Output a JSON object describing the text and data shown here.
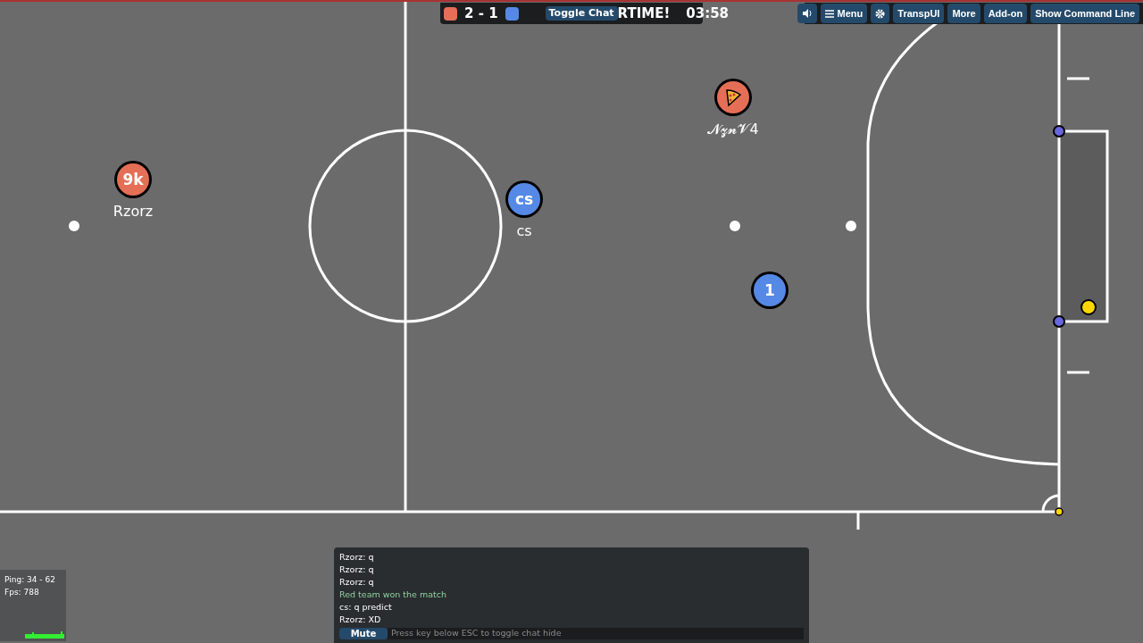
{
  "scoreboard": {
    "red_score": "2",
    "separator": "-",
    "blue_score": "1",
    "toggle_chat": "Toggle Chat",
    "banner": "RTIME!",
    "timer": "03:58"
  },
  "toolbar": [
    {
      "kind": "sound"
    },
    {
      "kind": "menu",
      "label": "Menu"
    },
    {
      "kind": "settings"
    },
    {
      "kind": "text",
      "label": "TranspUI"
    },
    {
      "kind": "text",
      "label": "More"
    },
    {
      "kind": "text",
      "label": "Add-on"
    },
    {
      "kind": "text",
      "label": "Show Command Line"
    }
  ],
  "players": [
    {
      "color": "#e56e56",
      "kind": "text",
      "avatar": "9k",
      "name": "Rzorz"
    },
    {
      "color": "#5689e5",
      "kind": "text",
      "avatar": "cs",
      "name": "cs"
    },
    {
      "color": "#e56e56",
      "kind": "pizza",
      "name": "𝓝𝔃𝓷𝓥4"
    },
    {
      "color": "#5689e5",
      "kind": "text",
      "avatar": "1"
    }
  ],
  "chat": {
    "messages": [
      {
        "kind": "chat",
        "text": "Rzorz: q"
      },
      {
        "kind": "chat",
        "text": "Rzorz: q"
      },
      {
        "kind": "chat",
        "text": "Rzorz: q"
      },
      {
        "kind": "notice",
        "text": "Red team won the match"
      },
      {
        "kind": "chat",
        "text": "cs: q predict"
      },
      {
        "kind": "chat",
        "text": "Rzorz: XD"
      }
    ],
    "mute": "Mute",
    "placeholder": "Press key below ESC to toggle chat hide"
  },
  "stats": {
    "ping": "Ping: 34 - 62",
    "fps": "Fps: 788"
  }
}
